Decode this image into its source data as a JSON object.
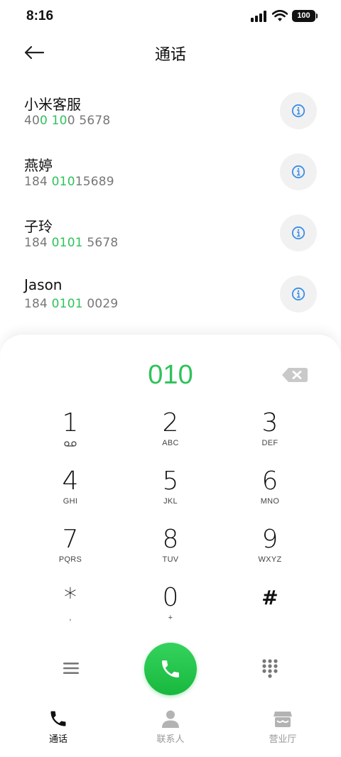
{
  "status_bar": {
    "time": "8:16",
    "battery": "100"
  },
  "header": {
    "title": "通话"
  },
  "contacts": [
    {
      "name": "小米客服",
      "number_parts": [
        "40",
        "0 10",
        "0 5678"
      ]
    },
    {
      "name": "燕婷",
      "number_parts": [
        "184 ",
        "010",
        "15689"
      ]
    },
    {
      "name": "子玲",
      "number_parts": [
        "184 ",
        "0101",
        " 5678"
      ]
    },
    {
      "name": "Jason",
      "number_parts": [
        "184 ",
        "0101",
        " 0029"
      ]
    }
  ],
  "dialpad": {
    "input_value": "010",
    "keys": [
      {
        "digit": "1",
        "letters": ""
      },
      {
        "digit": "2",
        "letters": "ABC"
      },
      {
        "digit": "3",
        "letters": "DEF"
      },
      {
        "digit": "4",
        "letters": "GHI"
      },
      {
        "digit": "5",
        "letters": "JKL"
      },
      {
        "digit": "6",
        "letters": "MNO"
      },
      {
        "digit": "7",
        "letters": "PQRS"
      },
      {
        "digit": "8",
        "letters": "TUV"
      },
      {
        "digit": "9",
        "letters": "WXYZ"
      },
      {
        "digit": "*",
        "letters": ","
      },
      {
        "digit": "0",
        "letters": "+"
      },
      {
        "digit": "#",
        "letters": ""
      }
    ]
  },
  "bottom_nav": [
    {
      "label": "通话",
      "icon": "phone-icon",
      "active": true
    },
    {
      "label": "联系人",
      "icon": "contacts-icon",
      "active": false
    },
    {
      "label": "营业厅",
      "icon": "store-icon",
      "active": false
    }
  ],
  "colors": {
    "accent_green": "#2fc25b",
    "info_blue": "#3a8ee6",
    "call_green": "#18b83e"
  }
}
